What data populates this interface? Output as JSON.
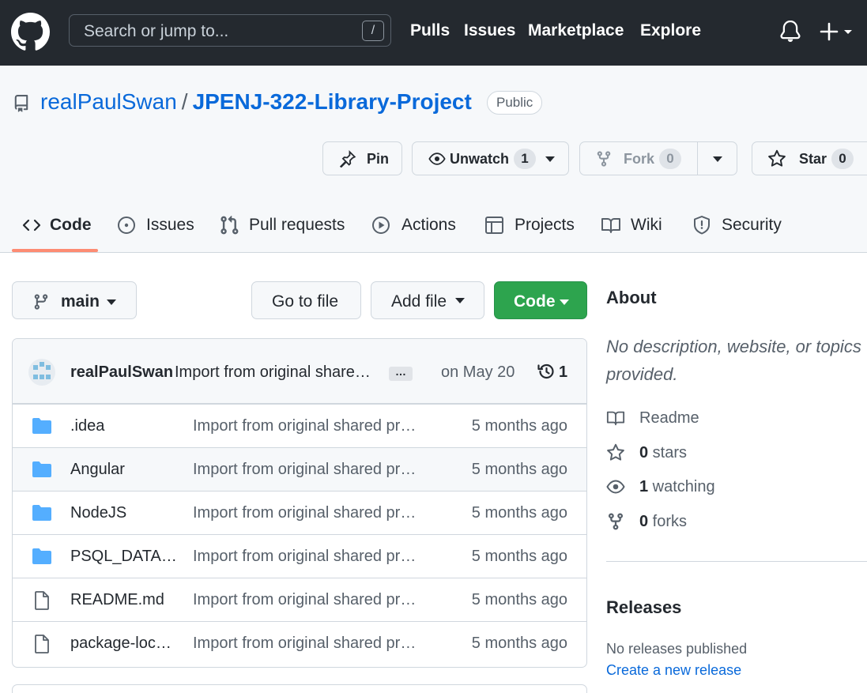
{
  "header": {
    "search_placeholder": "Search or jump to...",
    "search_shortcut": "/",
    "nav": [
      "Pulls",
      "Issues",
      "Marketplace",
      "Explore"
    ]
  },
  "repo": {
    "owner": "realPaulSwan",
    "separator": "/",
    "name": "JPENJ-322-Library-Project",
    "visibility": "Public",
    "actions": {
      "pin": "Pin",
      "unwatch": "Unwatch",
      "watch_count": "1",
      "fork": "Fork",
      "fork_count": "0",
      "star": "Star",
      "star_count": "0"
    },
    "tabs": [
      {
        "label": "Code",
        "icon": "code-icon",
        "active": true
      },
      {
        "label": "Issues",
        "icon": "issue-icon"
      },
      {
        "label": "Pull requests",
        "icon": "pull-request-icon"
      },
      {
        "label": "Actions",
        "icon": "play-icon"
      },
      {
        "label": "Projects",
        "icon": "table-icon"
      },
      {
        "label": "Wiki",
        "icon": "book-icon"
      },
      {
        "label": "Security",
        "icon": "shield-icon"
      }
    ]
  },
  "toolbar": {
    "branch": "main",
    "go_to_file": "Go to file",
    "add_file": "Add file",
    "code": "Code"
  },
  "commit": {
    "user": "realPaulSwan",
    "message": "Import from original share…",
    "ellipsis": "…",
    "date": "on May 20",
    "count": "1"
  },
  "files": [
    {
      "type": "folder",
      "name": ".idea",
      "message": "Import from original shared pr…",
      "age": "5 months ago"
    },
    {
      "type": "folder",
      "name": "Angular",
      "message": "Import from original shared pr…",
      "age": "5 months ago"
    },
    {
      "type": "folder",
      "name": "NodeJS",
      "message": "Import from original shared pr…",
      "age": "5 months ago"
    },
    {
      "type": "folder",
      "name": "PSQL_DATA…",
      "message": "Import from original shared pr…",
      "age": "5 months ago"
    },
    {
      "type": "file",
      "name": "README.md",
      "message": "Import from original shared pr…",
      "age": "5 months ago"
    },
    {
      "type": "file",
      "name": "package-loc…",
      "message": "Import from original shared pr…",
      "age": "5 months ago"
    }
  ],
  "sidebar": {
    "about_title": "About",
    "about_desc": "No description, website, or topics provided.",
    "readme": "Readme",
    "stars_count": "0",
    "stars_label": " stars",
    "watching_count": "1",
    "watching_label": " watching",
    "forks_count": "0",
    "forks_label": " forks",
    "releases_title": "Releases",
    "no_releases": "No releases published",
    "create_release": "Create a new release"
  },
  "colors": {
    "header_bg": "#24292f",
    "link": "#0969da",
    "green_button": "#2da44e",
    "folder_icon": "#54aeff",
    "active_tab_underline": "#fd8c73"
  }
}
